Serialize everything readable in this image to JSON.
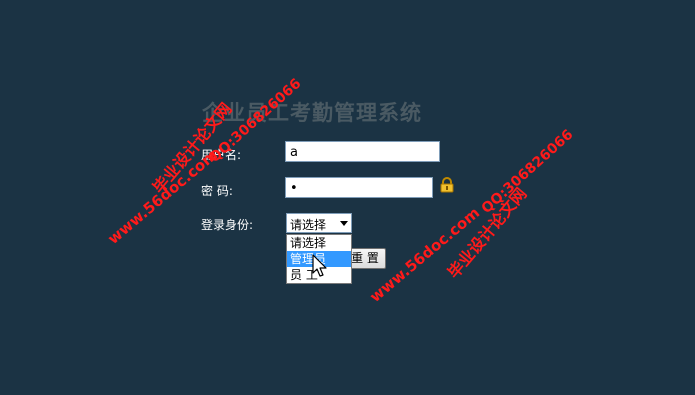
{
  "title": "企业员工考勤管理系统",
  "form": {
    "username_label": "用户名:",
    "username_value": "a",
    "password_label": "密  码:",
    "password_value": "•",
    "role_label": "登录身份:",
    "role_selected": "请选择",
    "role_options": [
      "请选择",
      "管理员",
      "员  工"
    ],
    "highlighted_option": "管理员",
    "reset_label": "重 置"
  },
  "watermarks": {
    "site": "www.56doc.com",
    "qq": "QQ:306826066",
    "brand": "毕业设计论文网"
  },
  "colors": {
    "background": "#1b3344",
    "watermark": "#ff1a1a",
    "highlight": "#3399ff"
  },
  "icons": [
    "lock-icon",
    "dropdown-arrow-icon",
    "mouse-cursor-icon"
  ]
}
